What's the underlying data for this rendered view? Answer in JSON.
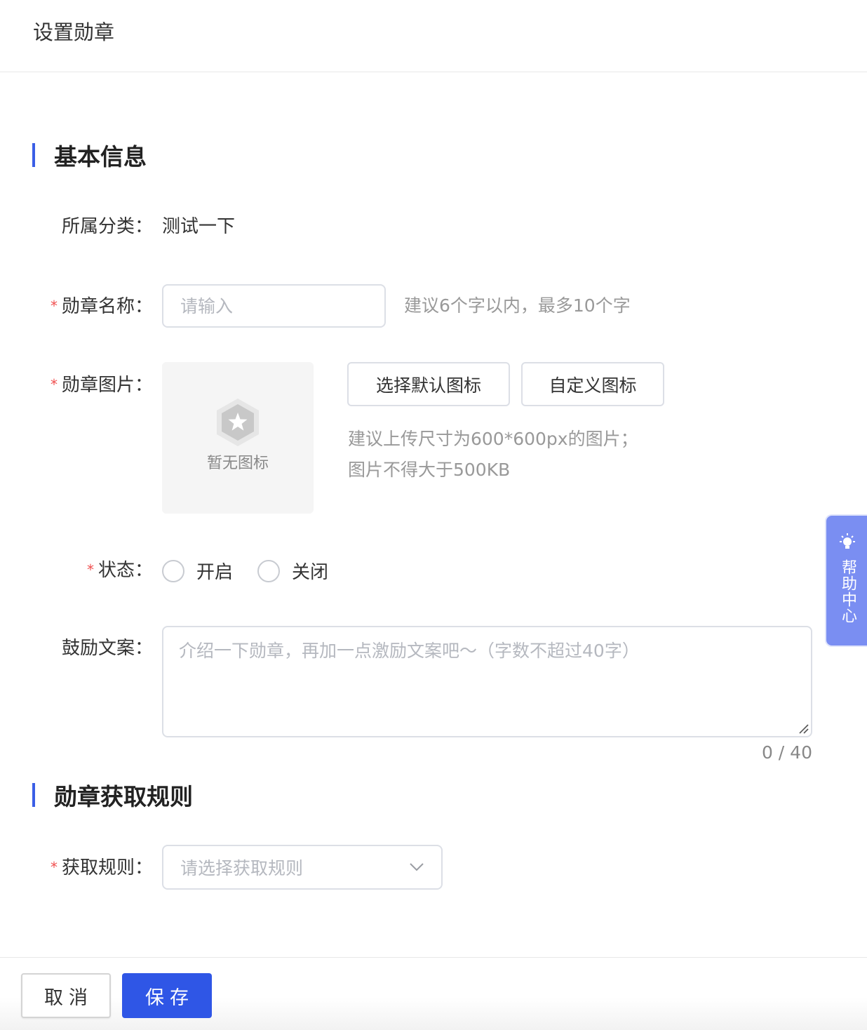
{
  "header": {
    "title": "设置勋章"
  },
  "sections": {
    "basic": "基本信息",
    "rules": "勋章获取规则"
  },
  "form": {
    "category": {
      "label": "所属分类：",
      "value": "测试一下"
    },
    "name": {
      "label": "勋章名称：",
      "placeholder": "请输入",
      "value": "",
      "hint": "建议6个字以内，最多10个字"
    },
    "image": {
      "label": "勋章图片：",
      "empty_text": "暂无图标",
      "default_button": "选择默认图标",
      "custom_button": "自定义图标",
      "hint_line1": "建议上传尺寸为600*600px的图片；",
      "hint_line2": "图片不得大于500KB"
    },
    "status": {
      "label": "状态：",
      "option_on": "开启",
      "option_off": "关闭"
    },
    "copy": {
      "label": "鼓励文案：",
      "placeholder": "介绍一下勋章，再加一点激励文案吧～（字数不超过40字）",
      "counter": "0 / 40"
    },
    "rule": {
      "label": "获取规则：",
      "placeholder": "请选择获取规则"
    },
    "required_mark": "*"
  },
  "help": {
    "label": "帮助中心"
  },
  "footer": {
    "cancel": "取消",
    "save": "保存"
  },
  "colors": {
    "accent": "#2f56e6",
    "section_bar": "#3a5ee6",
    "required": "#f05050",
    "help_tab": "#7a8ef2"
  },
  "icons": {
    "badge_placeholder": "hexagon-star-icon",
    "help": "lightbulb-icon",
    "select": "chevron-down-icon",
    "resize": "resize-grip-icon"
  }
}
